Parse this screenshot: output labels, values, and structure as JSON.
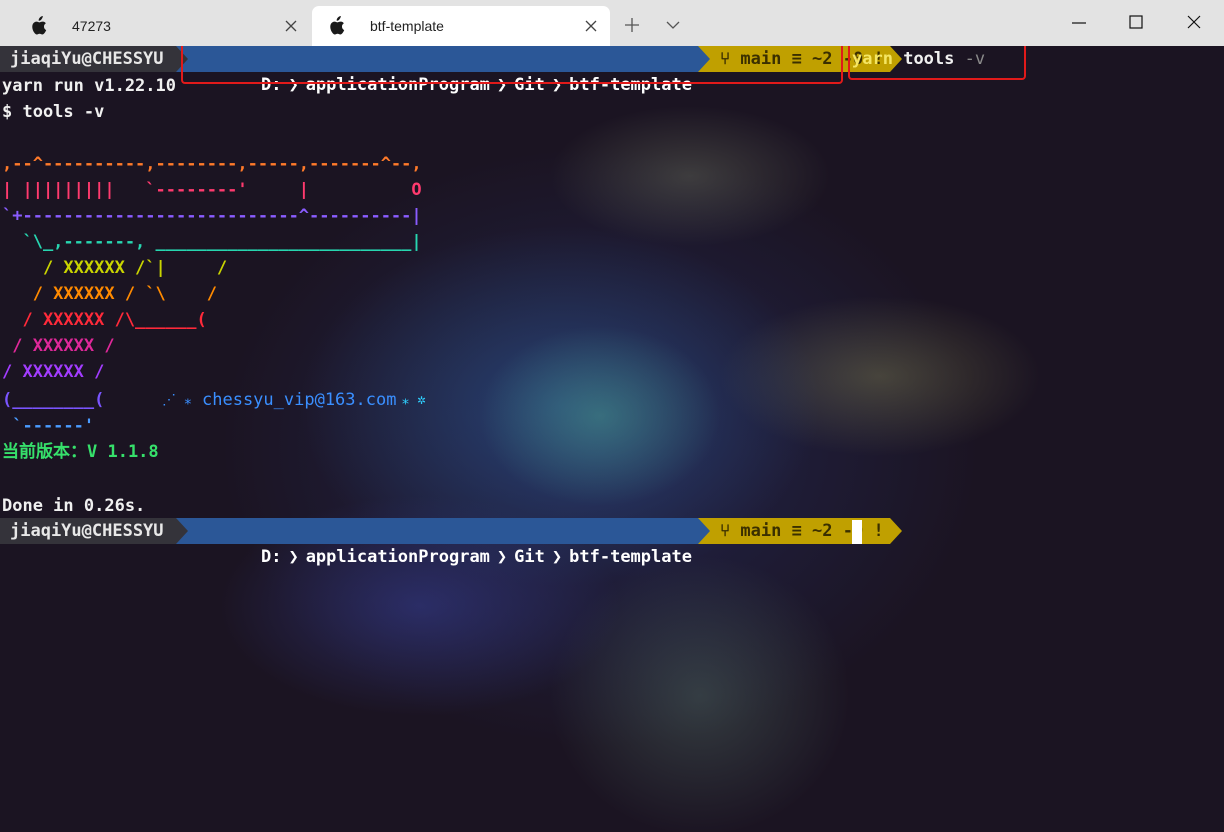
{
  "window": {
    "tabs": [
      {
        "label": "47273",
        "active": false
      },
      {
        "label": "btf-template",
        "active": true
      }
    ],
    "new_tab_glyph": "+",
    "dropdown_glyph": "⌵",
    "minimize_glyph": "—",
    "maximize_glyph": "☐",
    "close_glyph": "✕"
  },
  "prompt": {
    "user_host": "jiaqiYu@CHESSYU",
    "path": [
      "D:",
      "applicationProgram",
      "Git",
      "btf-template"
    ],
    "path_separator": "❯",
    "git_status": "⑂ main ≡ ~2 -0 !"
  },
  "command": {
    "yarn": "yarn",
    "tools": "tools",
    "flag": "-v"
  },
  "output": {
    "yarn_run": "yarn run v1.22.10",
    "script_line": "$ tools -v",
    "ascii_art": [
      {
        "text": ",--^----------,--------,-----,-------^--,",
        "color": "#ff7a2a"
      },
      {
        "text": "| |||||||||   `--------'     |          O",
        "color": "#ff3a6e"
      },
      {
        "text": "`+---------------------------^----------|",
        "color": "#8a5cff"
      },
      {
        "text": "  `\\_,-------, _________________________|",
        "color": "#27d6b0"
      },
      {
        "text": "    / XXXXXX /`|     /",
        "color": "#c9d400"
      },
      {
        "text": "   / XXXXXX / `\\    /",
        "color": "#ff8a00"
      },
      {
        "text": "  / XXXXXX /\\______(",
        "color": "#ff2a3a"
      },
      {
        "text": " / XXXXXX /",
        "color": "#e0289a"
      },
      {
        "text": "/ XXXXXX /",
        "color": "#a23cff"
      },
      {
        "text": "(________(",
        "color": "#7a55ff"
      },
      {
        "text": " `------'",
        "color": "#4a9bff"
      }
    ],
    "email_prefix": "⋰ ⁎",
    "email": "chessyu_vip@163.com",
    "email_suffix": "⁎ ✲",
    "version_label": "当前版本：",
    "version_value": "V 1.1.8",
    "done": "Done in 0.26s."
  },
  "colors": {
    "accent_red_box": "#e11a1a",
    "yarn_yellow": "#f5e663",
    "email_blue": "#3a8fff",
    "version_green": "#36e06b"
  }
}
